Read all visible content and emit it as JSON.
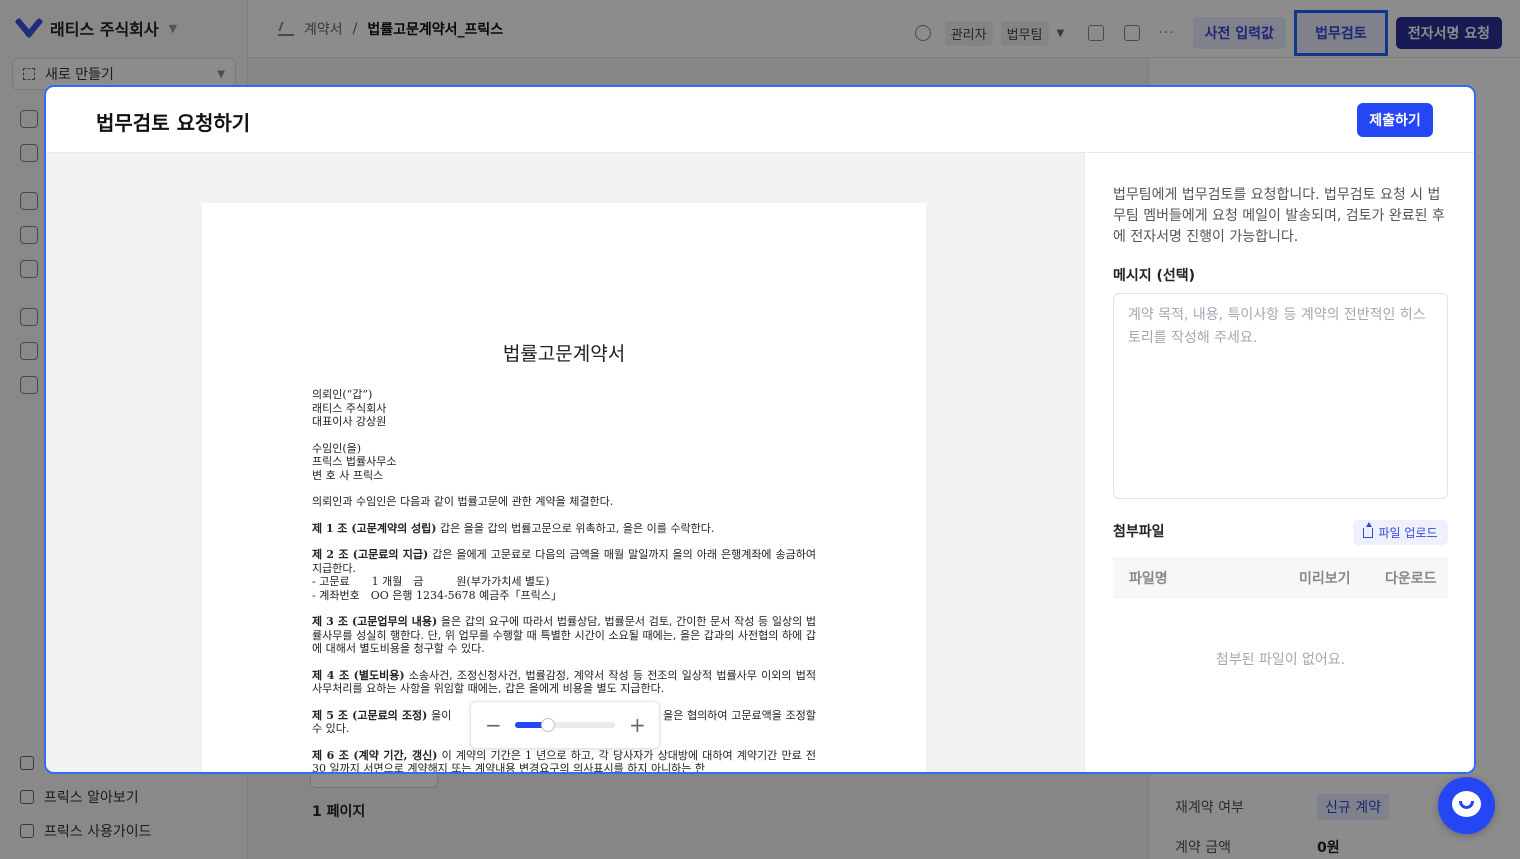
{
  "company": {
    "name": "래티스 주식회사"
  },
  "sidebar": {
    "new_label": "새로 만들기",
    "bottom_items": [
      "프릭스 알아보기",
      "프릭스 사용가이드"
    ]
  },
  "breadcrumb": {
    "parent": "계약서",
    "separator": "/",
    "current": "법률고문계약서_프릭스"
  },
  "header": {
    "chip_admin": "관리자",
    "chip_team": "법무팀",
    "more": "···",
    "btn_presets": "사전 입력값",
    "btn_legal": "법무검토",
    "btn_esign": "전자서명 요청"
  },
  "background": {
    "page_number": "1 페이지",
    "rows": [
      {
        "label": "재계약 여부",
        "value": "신규 계약"
      },
      {
        "label": "계약 금액",
        "value": "0원"
      }
    ]
  },
  "modal": {
    "title": "법무검토 요청하기",
    "submit": "제출하기",
    "description": "법무팀에게 법무검토를 요청합니다. 법무검토 요청 시 법무팀 멤버들에게 요청 메일이 발송되며, 검토가 완료된 후에 전자서명 진행이 가능합니다.",
    "message_label": "메시지 (선택)",
    "message_placeholder": "계약 목적, 내용, 특이사항 등 계약의 전반적인 히스토리를 작성해 주세요.",
    "attachments_label": "첨부파일",
    "upload_label": "파일 업로드",
    "table_headers": {
      "name": "파일명",
      "preview": "미리보기",
      "download": "다운로드"
    },
    "empty_text": "첨부된 파일이 없어요.",
    "zoom": {
      "minus": "−",
      "plus": "+",
      "level": 0.33
    }
  },
  "document": {
    "title": "법률고문계약서",
    "lines": {
      "client_head": "의뢰인(“갑”)",
      "client_name": "래티스 주식회사",
      "client_rep": "대표이사 강상원",
      "agent_head": "수임인(을)",
      "agent_name": "프릭스 법률사무소",
      "agent_rep": "변 호 사 프릭스",
      "intro": "의뢰인과 수임인은 다음과 같이 법률고문에 관한 계약을 체결한다.",
      "a1_title": "제 1 조 (고문계약의 성립)",
      "a1_text": " 갑은 을을 갑의 법률고문으로 위촉하고, 을은 이를 수락한다.",
      "a2_title": "제 2 조 (고문료의 지급)",
      "a2_text": " 갑은 을에게 고문료로 다음의 금액을 매월 말일까지 을의 아래 은행계좌에 송금하여 지급한다.",
      "a2_fee": "- 고문료　　1 개월　금　　　원(부가가치세 별도)",
      "a2_account": "- 계좌번호　OO 은행 1234-5678 예금주「프릭스」",
      "a3_title": "제 3 조 (고문업무의 내용)",
      "a3_text": " 을은 갑의 요구에 따라서 법률상담, 법률문서 검토, 간이한 문서 작성 등 일상의 법률사무를 성실히 행한다. 단, 위 업무를 수행할 때 특별한 시간이 소요될 때에는, 을은 갑과의 사전협의 하에 갑에 대해서 별도비용을 청구할 수 있다.",
      "a4_title": "제 4 조 (별도비용)",
      "a4_text": " 소송사건, 조정신청사건, 법률감정, 계약서 작성 등 전조의 일상적 법률사무 이외의 법적 사무처리를 요하는 사항을 위임할 때에는, 갑은 을에게 비용을 별도 지급한다.",
      "a5_title": "제 5 조 (고문료의 조정)",
      "a5_text": " 을이 　　　　　　　　　　　　　에 따라 갑과 을은 협의하여 고문료액을 조정할 수 있다.",
      "a6_title": "제 6 조 (계약 기간, 갱신)",
      "a6_text": " 이 계약의 기간은 1 년으로 하고, 각 당사자가 상대방에 대하여 계약기간 만료 전 30 일까지 서면으로 계약해지 또는 계약내용 변경요구의 의사표시를 하지 아니하는 한"
    }
  },
  "colors": {
    "accent": "#2446f5",
    "highlight": "#1f60ff",
    "esign": "#2e2f99"
  },
  "icons": [
    "logo-icon",
    "breadcrumb-contract-icon",
    "key-icon",
    "link-icon",
    "download-icon",
    "upload-icon",
    "chat-icon"
  ]
}
